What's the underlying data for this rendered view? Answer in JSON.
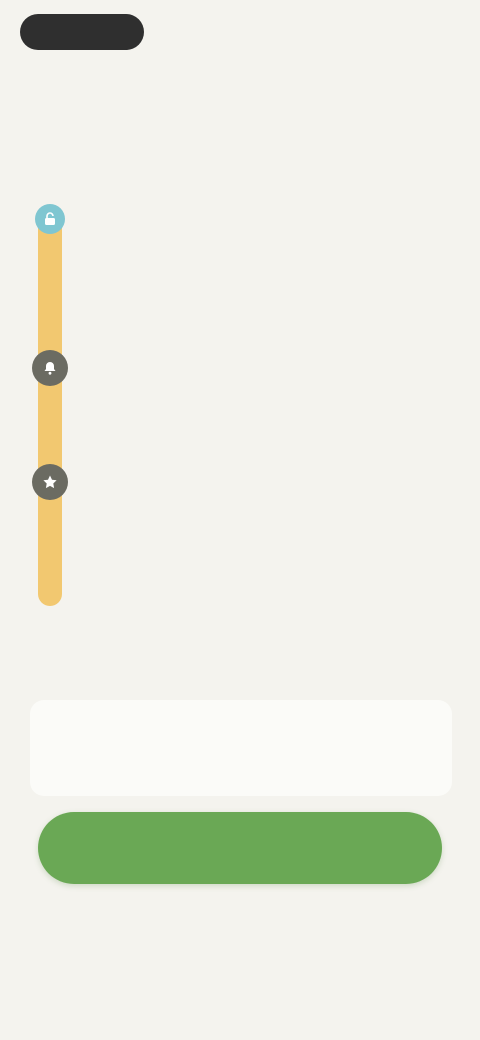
{
  "header": {
    "brand": "",
    "help": ""
  },
  "headline": "",
  "steps": [
    {
      "title": "",
      "text": ""
    },
    {
      "title": "",
      "text": ""
    },
    {
      "title": "",
      "text": ""
    }
  ],
  "reminder": {
    "label": "",
    "text": ""
  },
  "cta": {
    "label": ""
  },
  "secondary": {
    "label": ""
  },
  "footer": {
    "note": ""
  },
  "colors": {
    "background": "#f4f3ee",
    "accent_green": "#6aa855",
    "timeline_rail": "#f2c870",
    "first_node": "#7fc6d1",
    "node_dark": "#6b6b62"
  },
  "icons": [
    "unlock-icon",
    "bell-icon",
    "star-icon"
  ]
}
